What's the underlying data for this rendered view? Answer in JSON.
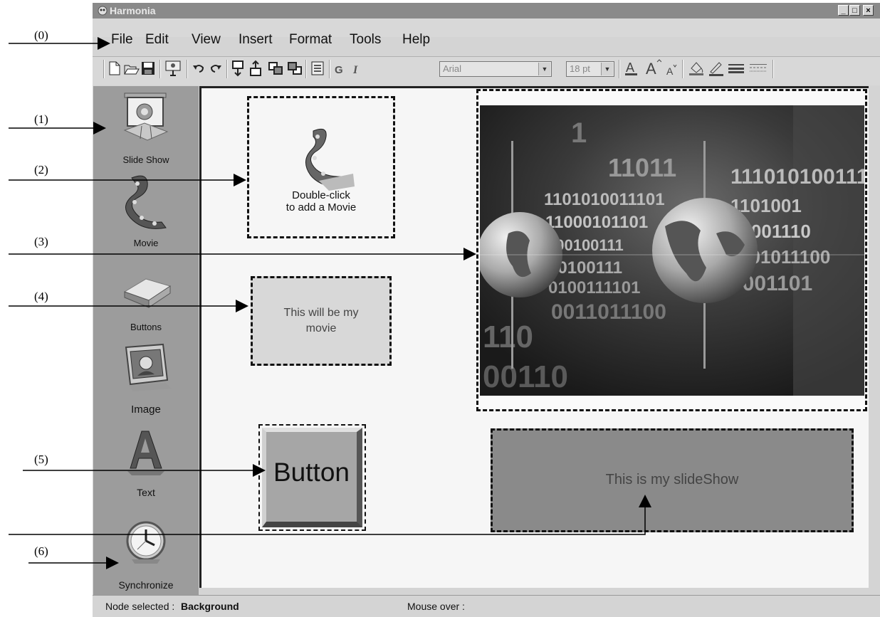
{
  "window": {
    "title": "Harmonia",
    "min_label": "_",
    "max_label": "□",
    "close_label": "×"
  },
  "callouts": [
    "(0)",
    "(1)",
    "(2)",
    "(3)",
    "(4)",
    "(5)",
    "(6)"
  ],
  "menu": [
    "File",
    "Edit",
    "View",
    "Insert",
    "Format",
    "Tools",
    "Help"
  ],
  "toolbar": {
    "font_name": "Arial",
    "font_size": "18 pt",
    "bold_label": "G",
    "italic_label": "I",
    "icons": [
      "new-icon",
      "open-icon",
      "save-icon",
      "preview-icon",
      "undo-icon",
      "redo-icon",
      "move-down-icon",
      "move-up-icon",
      "bring-front-icon",
      "send-back-icon",
      "properties-icon",
      "font-color-icon",
      "font-grow-icon",
      "font-shrink-icon",
      "fill-color-icon",
      "line-color-icon",
      "line-style-icon",
      "dash-style-icon"
    ]
  },
  "sidebar": {
    "items": [
      {
        "label": "Slide Show",
        "icon": "slideshow-icon"
      },
      {
        "label": "Movie",
        "icon": "movie-icon"
      },
      {
        "label": "Buttons",
        "icon": "buttons-icon"
      },
      {
        "label": "Image",
        "icon": "image-icon"
      },
      {
        "label": "Text",
        "icon": "text-icon"
      },
      {
        "label": "Synchronize",
        "icon": "clock-icon"
      }
    ]
  },
  "canvas": {
    "movie_placeholder_line1": "Double-click",
    "movie_placeholder_line2": "to add a Movie",
    "text_box_line1": "This will be my",
    "text_box_line2": "movie",
    "button_label": "Button",
    "slideshow_label": "This is my slideShow",
    "image_digits": [
      "1",
      "11011",
      "1101010011101",
      "11000101101",
      "100100111",
      "10100111",
      "0100111101",
      "0011011100",
      "1101001",
      "01001110",
      "1101011100",
      "110",
      "00110",
      "111010100111",
      "0001101"
    ]
  },
  "status": {
    "node_selected_label": "Node selected :",
    "node_selected_value": "Background",
    "mouse_over_label": "Mouse over :"
  }
}
